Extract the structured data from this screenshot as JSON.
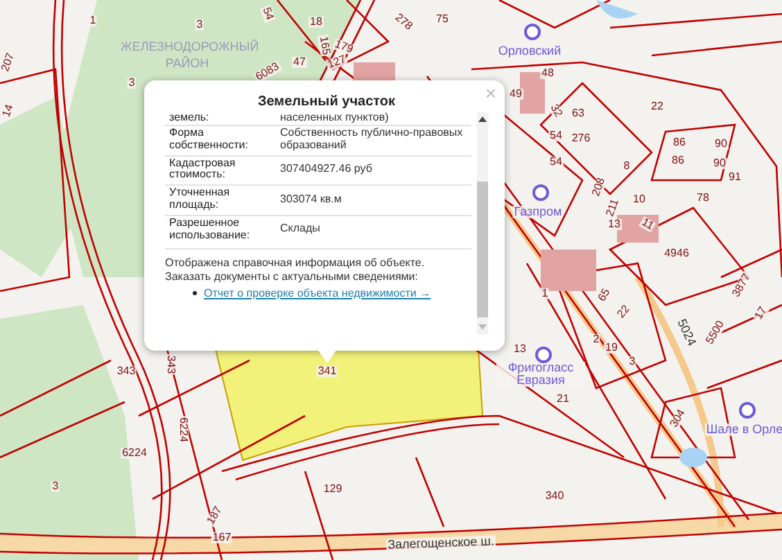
{
  "map_labels": [
    {
      "kind": "district",
      "text": "ЖЕЛЕЗНОДОРОЖНЫЙ РАЙОН"
    },
    {
      "kind": "number",
      "text": "1"
    },
    {
      "kind": "number",
      "text": "3"
    },
    {
      "kind": "number",
      "text": "3"
    },
    {
      "kind": "number",
      "text": "6083"
    },
    {
      "kind": "number",
      "text": "54"
    },
    {
      "kind": "number",
      "text": "18"
    },
    {
      "kind": "number",
      "text": "47"
    },
    {
      "kind": "number",
      "text": "165"
    },
    {
      "kind": "number",
      "text": "179"
    },
    {
      "kind": "number",
      "text": "127"
    },
    {
      "kind": "number",
      "text": "278"
    },
    {
      "kind": "number",
      "text": "75"
    },
    {
      "kind": "poi",
      "text": "Орловский"
    },
    {
      "kind": "number",
      "text": "48"
    },
    {
      "kind": "number",
      "text": "49"
    },
    {
      "kind": "number",
      "text": "32"
    },
    {
      "kind": "number",
      "text": "63"
    },
    {
      "kind": "number",
      "text": "22"
    },
    {
      "kind": "number",
      "text": "54"
    },
    {
      "kind": "number",
      "text": "276"
    },
    {
      "kind": "number",
      "text": "86"
    },
    {
      "kind": "number",
      "text": "86"
    },
    {
      "kind": "number",
      "text": "90"
    },
    {
      "kind": "number",
      "text": "90"
    },
    {
      "kind": "number",
      "text": "91"
    },
    {
      "kind": "number",
      "text": "54"
    },
    {
      "kind": "number",
      "text": "208"
    },
    {
      "kind": "number",
      "text": "8"
    },
    {
      "kind": "number",
      "text": "78"
    },
    {
      "kind": "number",
      "text": "10"
    },
    {
      "kind": "number",
      "text": "211"
    },
    {
      "kind": "number",
      "text": "13"
    },
    {
      "kind": "number",
      "text": "11"
    },
    {
      "kind": "number",
      "text": "4946"
    },
    {
      "kind": "poi",
      "text": "Газпром"
    },
    {
      "kind": "number",
      "text": "1"
    },
    {
      "kind": "number",
      "text": "65"
    },
    {
      "kind": "number",
      "text": "22"
    },
    {
      "kind": "number",
      "text": "2"
    },
    {
      "kind": "number",
      "text": "19"
    },
    {
      "kind": "number",
      "text": "3"
    },
    {
      "kind": "number",
      "text": "13"
    },
    {
      "kind": "poi",
      "text": "Фригогласс Евразия"
    },
    {
      "kind": "number",
      "text": "21"
    },
    {
      "kind": "number",
      "text": "5500"
    },
    {
      "kind": "number",
      "text": "3877"
    },
    {
      "kind": "number",
      "text": "17"
    },
    {
      "kind": "number",
      "text": "304"
    },
    {
      "kind": "poi",
      "text": "Шале в Орле"
    },
    {
      "kind": "number",
      "text": "340"
    },
    {
      "kind": "road",
      "text": "Залегощенское ш."
    },
    {
      "kind": "road",
      "text": "5024"
    },
    {
      "kind": "number",
      "text": "343"
    },
    {
      "kind": "number",
      "text": "343"
    },
    {
      "kind": "number",
      "text": "6224"
    },
    {
      "kind": "number",
      "text": "6224"
    },
    {
      "kind": "number",
      "text": "3"
    },
    {
      "kind": "number",
      "text": "129"
    },
    {
      "kind": "number",
      "text": "187"
    },
    {
      "kind": "number",
      "text": "167"
    },
    {
      "kind": "number",
      "text": "341"
    },
    {
      "kind": "number",
      "text": "207"
    },
    {
      "kind": "number",
      "text": "14"
    }
  ],
  "popup": {
    "title": "Земельный участок",
    "close": "×",
    "rows": [
      {
        "label": "земель:",
        "value": "населенных пунктов)"
      },
      {
        "label": "Форма собственности:",
        "value": "Собственность публично-правовых образований"
      },
      {
        "label": "Кадастровая стоимость:",
        "value": "307404927.46 руб"
      },
      {
        "label": "Уточненная площадь:",
        "value": "303074 кв.м"
      },
      {
        "label": "Разрешенное использование:",
        "value": "Склады"
      }
    ],
    "note": "Отображена справочная информация об объекте. Заказать документы с актуальными сведениями:",
    "link": "Отчет о проверке объекта недвижимости →"
  }
}
